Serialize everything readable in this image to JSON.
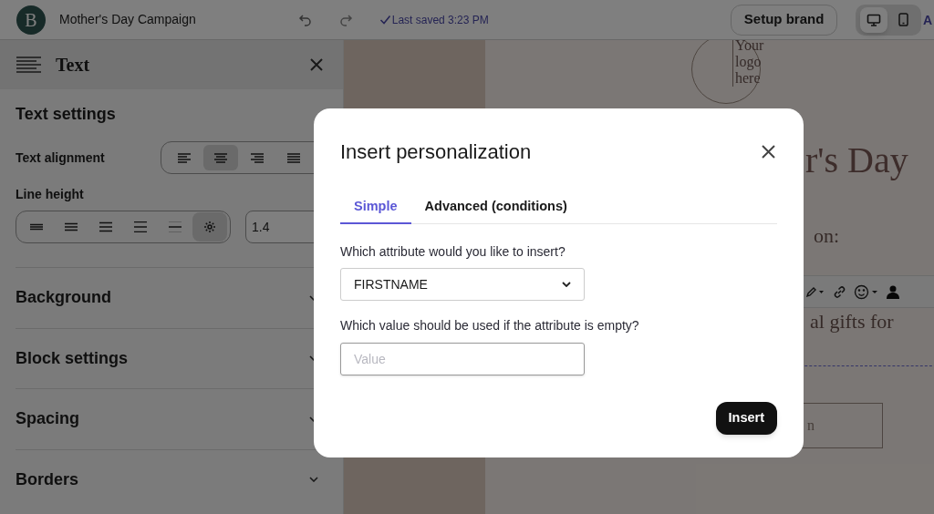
{
  "topbar": {
    "logo_letter": "B",
    "campaign_title": "Mother's Day Campaign",
    "save_status": "Last saved 3:23 PM",
    "setup_button": "Setup brand",
    "devices": [
      {
        "kind": "desktop",
        "selected": true
      },
      {
        "kind": "mobile",
        "selected": false
      }
    ],
    "cut_label": "A"
  },
  "sidebar": {
    "title": "Text",
    "section_title": "Text settings",
    "alignment": {
      "label": "Text alignment",
      "options": [
        {
          "kind": "left",
          "selected": false
        },
        {
          "kind": "center",
          "selected": true
        },
        {
          "kind": "right",
          "selected": false
        },
        {
          "kind": "justify",
          "selected": false
        }
      ]
    },
    "line_height": {
      "label": "Line height",
      "options": [
        {
          "kind": "lines",
          "selected": false
        },
        {
          "kind": "lines",
          "selected": false
        },
        {
          "kind": "lines",
          "selected": false
        },
        {
          "kind": "lines",
          "selected": false
        },
        {
          "kind": "lines",
          "selected": false
        },
        {
          "kind": "gear",
          "selected": true
        }
      ],
      "value": "1.4"
    },
    "sections": [
      "Background",
      "Block settings",
      "Spacing",
      "Borders"
    ]
  },
  "email": {
    "logo_text": "Your logo here",
    "heading": "r's Day",
    "subheading": "on:",
    "body_text": "al gifts for",
    "button_text": "n"
  },
  "dialog": {
    "title": "Insert personalization",
    "tabs": [
      {
        "label": "Simple",
        "selected": true
      },
      {
        "label": "Advanced (conditions)",
        "selected": false
      }
    ],
    "attribute_label": "Which attribute would you like to insert?",
    "attribute_value": "FIRSTNAME",
    "fallback_label": "Which value should be used if the attribute is empty?",
    "fallback_placeholder": "Value",
    "insert_button": "Insert"
  }
}
